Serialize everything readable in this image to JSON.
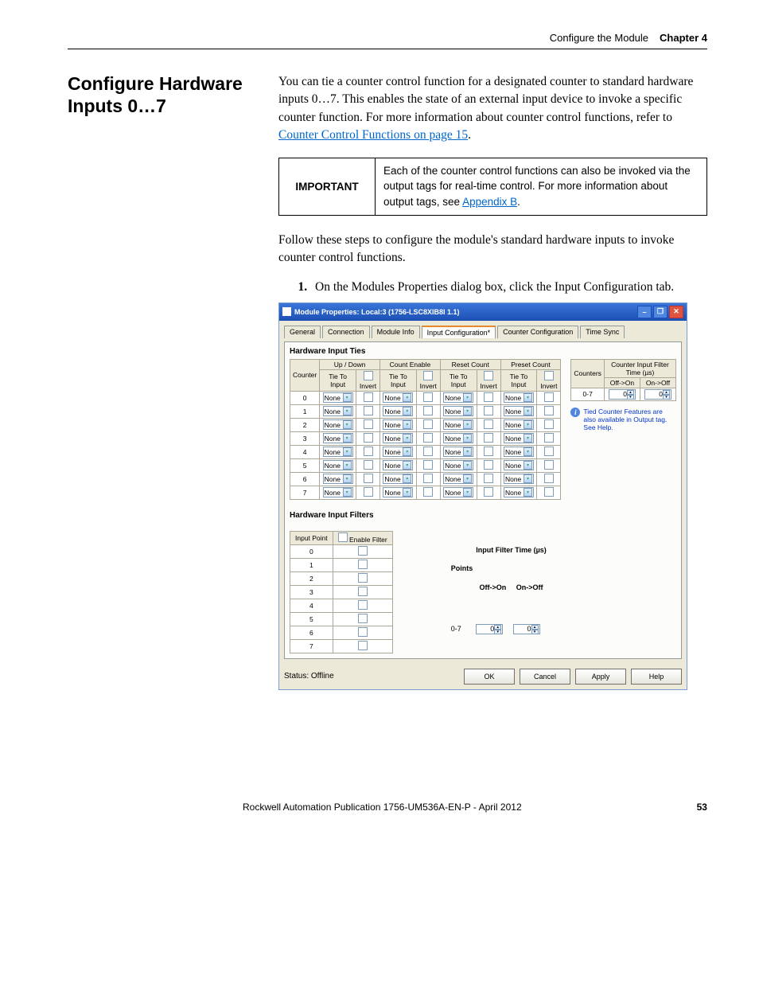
{
  "header": {
    "section": "Configure the Module",
    "chapter": "Chapter 4"
  },
  "title": "Configure Hardware Inputs 0…7",
  "intro": "You can tie a counter control function for a designated counter to standard hardware inputs 0…7. This enables the state of an external input device to invoke a specific counter function. For more information about counter control functions, refer to ",
  "intro_link": "Counter Control Functions on page 15",
  "intro_tail": ".",
  "important": {
    "label": "IMPORTANT",
    "text": "Each of the counter control functions can also be invoked via the output tags for real-time control. For more information about output tags, see ",
    "link": "Appendix B",
    "tail": "."
  },
  "follow": "Follow these steps to configure the module's standard hardware inputs to invoke counter control functions.",
  "step1": "On the Modules Properties dialog box, click the Input Configuration tab.",
  "dialog": {
    "title": "Module Properties: Local:3 (1756-LSC8XIB8I 1.1)",
    "tabs": [
      "General",
      "Connection",
      "Module Info",
      "Input Configuration*",
      "Counter Configuration",
      "Time Sync"
    ],
    "hw_ties": "Hardware Input Ties",
    "hw_filters": "Hardware Input Filters",
    "groups": [
      "Up / Down",
      "Count Enable",
      "Reset Count",
      "Preset Count"
    ],
    "sub_tie": "Tie To Input",
    "sub_invert": "Invert",
    "counter_col": "Counter",
    "dd_value": "None",
    "rows": [
      "0",
      "1",
      "2",
      "3",
      "4",
      "5",
      "6",
      "7"
    ],
    "side": {
      "counters": "Counters",
      "time_hdr": "Counter Input Filter Time (µs)",
      "off_on": "Off->On",
      "on_off": "On->Off",
      "range": "0-7",
      "zero": "0",
      "note": "Tied Counter Features are also available in Output tag. See Help."
    },
    "filters": {
      "input_point": "Input Point",
      "enable_filter": "Enable Filter",
      "points": "Points",
      "time_hdr": "Input Filter Time (µs)",
      "off_on": "Off->On",
      "on_off": "On->Off",
      "range": "0-7",
      "zero": "0"
    },
    "status": "Status: Offline",
    "buttons": {
      "ok": "OK",
      "cancel": "Cancel",
      "apply": "Apply",
      "help": "Help"
    }
  },
  "footer": {
    "pub": "Rockwell Automation Publication 1756-UM536A-EN-P - April 2012",
    "page": "53"
  }
}
